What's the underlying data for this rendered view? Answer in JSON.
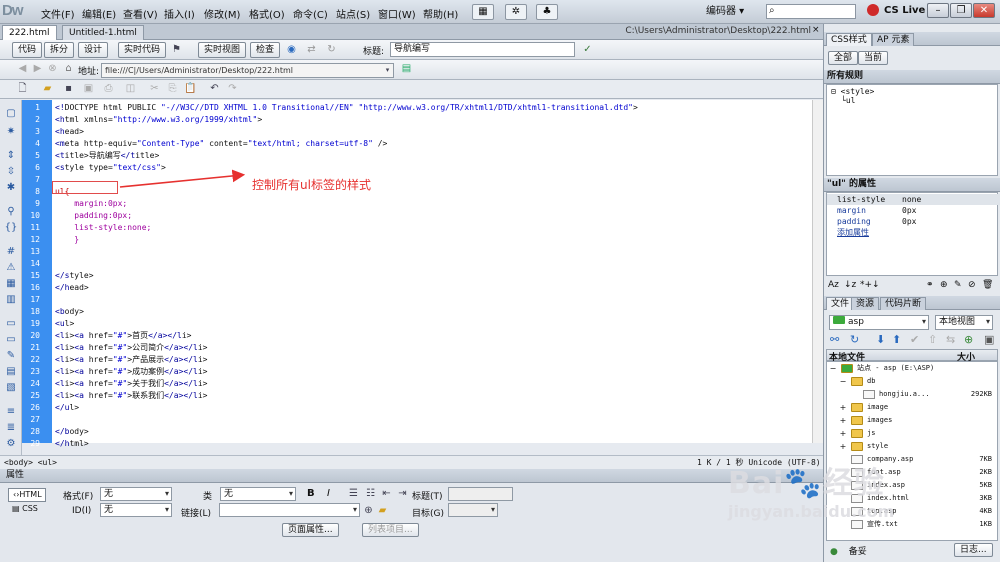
{
  "menubar": {
    "logo": "Dw",
    "items": [
      "文件(F)",
      "编辑(E)",
      "查看(V)",
      "插入(I)",
      "修改(M)",
      "格式(O)",
      "命令(C)",
      "站点(S)",
      "窗口(W)",
      "帮助(H)"
    ],
    "workspace": "编码器 ▾",
    "cslive": "CS Live",
    "win_min": "–",
    "win_max": "❐",
    "win_close": "✕"
  },
  "doc_tabs": {
    "tabs": [
      "222.html",
      "Untitled-1.html"
    ],
    "path": "C:\\Users\\Administrator\\Desktop\\222.html",
    "close": "×"
  },
  "toolbar": {
    "code": "代码",
    "split": "拆分",
    "design": "设计",
    "live_code": "实时代码",
    "live_view": "实时视图",
    "inspect": "检查",
    "title_label": "标题:",
    "title_value": "导航编写"
  },
  "address": {
    "label": "地址:",
    "value": "file:///C|/Users/Administrator/Desktop/222.html"
  },
  "code_lines": [
    "<!DOCTYPE html PUBLIC \"-//W3C//DTD XHTML 1.0 Transitional//EN\" \"http://www.w3.org/TR/xhtml1/DTD/xhtml1-transitional.dtd\">",
    "<html xmlns=\"http://www.w3.org/1999/xhtml\">",
    "<head>",
    "<meta http-equiv=\"Content-Type\" content=\"text/html; charset=utf-8\" />",
    "<title>导航编写</title>",
    "<style type=\"text/css\">",
    "",
    "ul{",
    "    margin:0px;",
    "    padding:0px;",
    "    list-style:none;",
    "    }",
    "",
    "",
    "</style>",
    "</head>",
    "",
    "<body>",
    "<ul>",
    "<li><a href=\"#\">首页</a></li>",
    "<li><a href=\"#\">公司简介</a></li>",
    "<li><a href=\"#\">产品展示</a></li>",
    "<li><a href=\"#\">成功案例</a></li>",
    "<li><a href=\"#\">关于我们</a></li>",
    "<li><a href=\"#\">联系我们</a></li>",
    "</ul>",
    "",
    "</body>",
    "</html>"
  ],
  "annotation": "控制所有ul标签的样式",
  "statusbar": {
    "tags": "<body> <ul>",
    "info": "1 K / 1 秒  Unicode (UTF-8)"
  },
  "properties": {
    "title": "属性",
    "html_btn": "HTML",
    "css_btn": "CSS",
    "format_label": "格式(F)",
    "format_value": "无",
    "class_label": "类",
    "class_value": "无",
    "id_label": "ID(I)",
    "id_value": "无",
    "link_label": "链接(L)",
    "heading_label": "标题(T)",
    "target_label": "目标(G)",
    "page_props": "页面属性...",
    "list_item": "列表项目..."
  },
  "css_panel": {
    "tab_css": "CSS样式",
    "tab_ap": "AP 元素",
    "btn_all": "全部",
    "btn_current": "当前",
    "all_rules": "所有规则",
    "rule_style": "<style>",
    "rule_ul": "ul",
    "props_title": "\"ul\" 的属性",
    "props": [
      {
        "k": "list-style",
        "v": "none"
      },
      {
        "k": "margin",
        "v": "0px"
      },
      {
        "k": "padding",
        "v": "0px"
      }
    ],
    "add_prop": "添加属性"
  },
  "files_panel": {
    "tab_files": "文件",
    "tab_assets": "资源",
    "tab_snippets": "代码片断",
    "site": "asp",
    "view": "本地视图",
    "col_name": "本地文件",
    "col_size": "大小",
    "items": [
      {
        "name": "站点 - asp (E:\\ASP)",
        "size": "",
        "level": 0,
        "type": "folder",
        "exp": "−"
      },
      {
        "name": "db",
        "size": "",
        "level": 1,
        "type": "folder",
        "exp": "−"
      },
      {
        "name": "hongjiu.a...",
        "size": "292KB",
        "level": 2,
        "type": "file",
        "exp": ""
      },
      {
        "name": "image",
        "size": "",
        "level": 1,
        "type": "folder",
        "exp": "+"
      },
      {
        "name": "images",
        "size": "",
        "level": 1,
        "type": "folder",
        "exp": "+"
      },
      {
        "name": "js",
        "size": "",
        "level": 1,
        "type": "folder",
        "exp": "+"
      },
      {
        "name": "style",
        "size": "",
        "level": 1,
        "type": "folder",
        "exp": "+"
      },
      {
        "name": "company.asp",
        "size": "7KB",
        "level": 1,
        "type": "file",
        "exp": ""
      },
      {
        "name": "foot.asp",
        "size": "2KB",
        "level": 1,
        "type": "file",
        "exp": ""
      },
      {
        "name": "index.asp",
        "size": "5KB",
        "level": 1,
        "type": "file",
        "exp": ""
      },
      {
        "name": "index.html",
        "size": "3KB",
        "level": 1,
        "type": "file",
        "exp": ""
      },
      {
        "name": "top.asp",
        "size": "4KB",
        "level": 1,
        "type": "file",
        "exp": ""
      },
      {
        "name": "宣传.txt",
        "size": "1KB",
        "level": 1,
        "type": "file",
        "exp": ""
      }
    ],
    "ready": "备妥",
    "log": "日志..."
  },
  "watermark": {
    "line1": "Bai🐾经验",
    "line2": "jingyan.baidu.com"
  },
  "colors": {
    "accent": "#3b8ff0",
    "annotation": "#e6312f",
    "tag": "#00009c",
    "css": "#9e009e"
  }
}
